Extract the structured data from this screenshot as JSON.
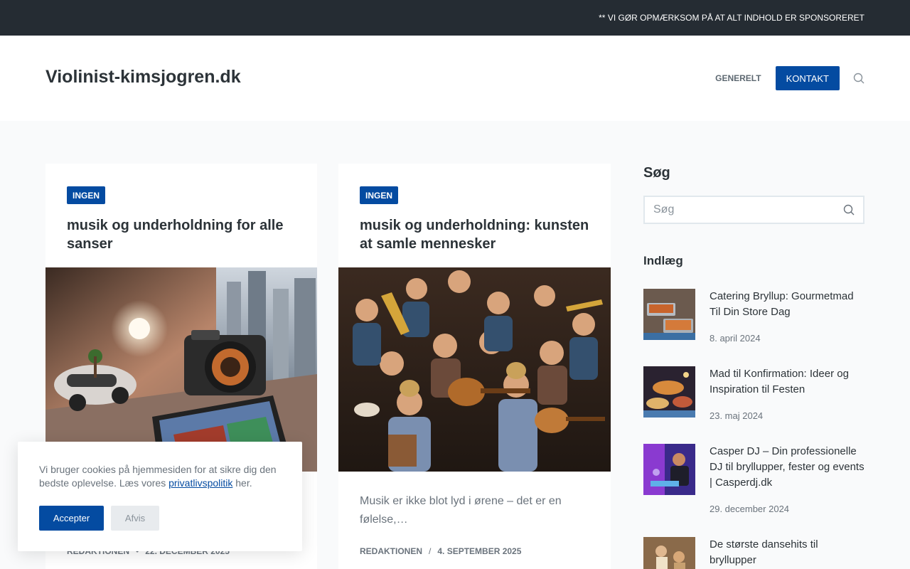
{
  "topbar": {
    "notice": "** VI GØR OPMÆRKSOM PÅ AT ALT INDHOLD ER SPONSORERET"
  },
  "header": {
    "site_title": "Violinist-kimsjogren.dk",
    "nav": [
      {
        "label": "GENERELT"
      },
      {
        "label": "KONTAKT"
      }
    ],
    "search_icon": "search-icon"
  },
  "cards": [
    {
      "badge": "INGEN",
      "title": "musik og underholdning for alle sanser",
      "excerpt": "",
      "author": "REDAKTIONEN",
      "date": "22. DECEMBER 2025"
    },
    {
      "badge": "INGEN",
      "title": "musik og underholdning: kunsten at samle mennesker",
      "excerpt": "Musik er ikke blot lyd i ørene – det er en følelse,…",
      "author": "REDAKTIONEN",
      "date": "4. SEPTEMBER 2025"
    }
  ],
  "sidebar": {
    "search_title": "Søg",
    "search_placeholder": "Søg",
    "posts_title": "Indlæg",
    "posts": [
      {
        "title": "Catering Bryllup: Gourmetmad Til Din Store Dag",
        "date": "8. april 2024"
      },
      {
        "title": "Mad til Konfirmation: Ideer og Inspiration til Festen",
        "date": "23. maj 2024"
      },
      {
        "title": "Casper DJ – Din professionelle DJ til bryllupper, fester og events | Casperdj.dk",
        "date": "29. december 2024"
      },
      {
        "title": "De største dansehits til bryllupper",
        "date": ""
      }
    ]
  },
  "cookie": {
    "text_before": "Vi bruger cookies på hjemmesiden for at sikre dig den bedste oplevelse. Læs vores ",
    "link": "privatlivspolitik",
    "text_after": " her.",
    "accept": "Accepter",
    "decline": "Afvis"
  },
  "colors": {
    "accent": "#044ba1",
    "topbar_bg": "#252c33",
    "page_bg": "#f9fafb"
  }
}
